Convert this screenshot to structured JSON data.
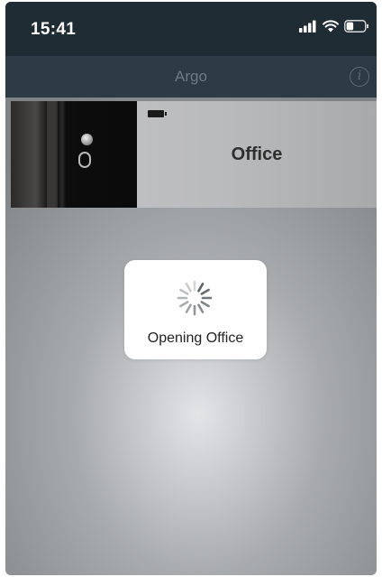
{
  "status_bar": {
    "time": "15:41",
    "icons": [
      "signal-icon",
      "wifi-icon",
      "battery-icon"
    ]
  },
  "nav": {
    "title": "Argo",
    "info_icon": "info-icon",
    "info_glyph": "i"
  },
  "lock_card": {
    "name": "Office",
    "battery_icon": "battery-icon"
  },
  "progress_hud": {
    "message": "Opening Office",
    "icon": "spinner-icon"
  },
  "colors": {
    "status_bar_bg": "#202c34",
    "nav_bar_bg": "#2d3b47",
    "nav_title": "#6c7b87"
  }
}
